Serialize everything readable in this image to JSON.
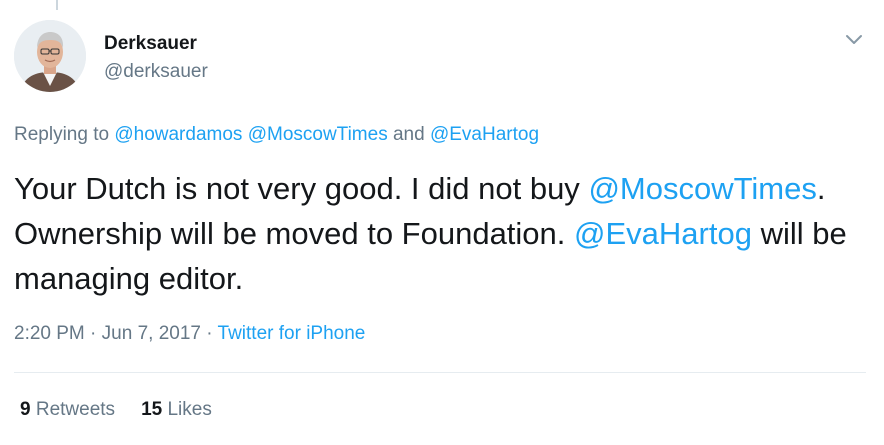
{
  "author": {
    "name": "Derksauer",
    "handle": "@derksauer"
  },
  "replying": {
    "prefix": "Replying to ",
    "users": [
      "@howardamos",
      "@MoscowTimes",
      "@EvaHartog"
    ],
    "separator": " ",
    "conjunction": " and "
  },
  "tweet": {
    "segments": [
      {
        "text": "Your Dutch is not very good. I did not buy ",
        "mention": false
      },
      {
        "text": "@MoscowTimes",
        "mention": true
      },
      {
        "text": ". Ownership will be moved to Foundation. ",
        "mention": false
      },
      {
        "text": "@EvaHartog",
        "mention": true
      },
      {
        "text": " will be managing editor.",
        "mention": false
      }
    ]
  },
  "meta": {
    "time": "2:20 PM",
    "dot": " · ",
    "date": "Jun 7, 2017",
    "source": "Twitter for iPhone"
  },
  "stats": {
    "retweets_count": "9",
    "retweets_label": "Retweets",
    "likes_count": "15",
    "likes_label": "Likes"
  },
  "icons": {
    "menu": "chevron-down-icon"
  },
  "colors": {
    "link": "#1da1f2",
    "secondary": "#657786",
    "primary": "#14171a"
  }
}
